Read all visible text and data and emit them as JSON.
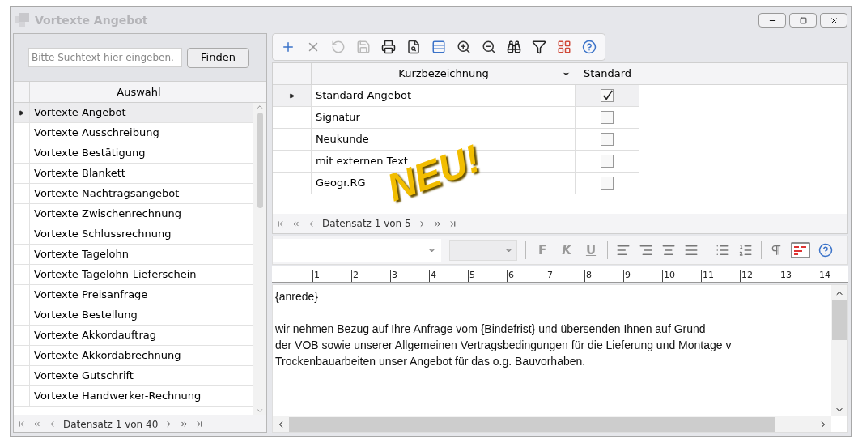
{
  "window": {
    "title": "Vortexte Angebot"
  },
  "search": {
    "placeholder": "Bitte Suchtext hier eingeben.",
    "button": "Finden"
  },
  "list": {
    "column": "Auswahl",
    "rows": [
      {
        "label": "Vortexte Angebot",
        "selected": true
      },
      {
        "label": "Vortexte Ausschreibung",
        "selected": false
      },
      {
        "label": "Vortexte Bestätigung",
        "selected": false
      },
      {
        "label": "Vortexte Blankett",
        "selected": false
      },
      {
        "label": "Vortexte Nachtragsangebot",
        "selected": false
      },
      {
        "label": "Vortexte Zwischenrechnung",
        "selected": false
      },
      {
        "label": "Vortexte Schlussrechnung",
        "selected": false
      },
      {
        "label": "Vortexte Tagelohn",
        "selected": false
      },
      {
        "label": "Vortexte Tagelohn-Lieferschein",
        "selected": false
      },
      {
        "label": "Vortexte Preisanfrage",
        "selected": false
      },
      {
        "label": "Vortexte Bestellung",
        "selected": false
      },
      {
        "label": "Vortexte Akkordauftrag",
        "selected": false
      },
      {
        "label": "Vortexte Akkordabrechnung",
        "selected": false
      },
      {
        "label": "Vortexte Gutschrift",
        "selected": false
      },
      {
        "label": "Vortexte Handwerker-Rechnung",
        "selected": false
      }
    ],
    "navigator": "Datensatz 1 von 40"
  },
  "grid": {
    "columns": [
      "Kurzbezeichnung",
      "Standard"
    ],
    "rows": [
      {
        "name": "Standard-Angebot",
        "standard": true,
        "selected": true
      },
      {
        "name": "Signatur",
        "standard": false,
        "selected": false
      },
      {
        "name": "Neukunde",
        "standard": false,
        "selected": false
      },
      {
        "name": "mit externen Text",
        "standard": false,
        "selected": false
      },
      {
        "name": "Geogr.RG",
        "standard": false,
        "selected": false
      }
    ],
    "navigator": "Datensatz 1 von 5"
  },
  "stamp": "NEU!",
  "editor": {
    "formatting": [
      "F",
      "K",
      "U"
    ],
    "ruler": [
      "1",
      "2",
      "3",
      "4",
      "5",
      "6",
      "7",
      "8",
      "9",
      "10",
      "11",
      "12",
      "13",
      "14"
    ],
    "paragraphs": [
      [
        "{anrede}"
      ],
      [
        "wir nehmen Bezug auf Ihre Anfrage vom {Bindefrist} und übersenden Ihnen auf Grund",
        "der VOB sowie unserer Allgemeinen Vertragsbedingungen für die Lieferung und Montage v",
        "Trockenbauarbeiten unser Angebot für das o.g. Bauvorhaben."
      ]
    ]
  }
}
